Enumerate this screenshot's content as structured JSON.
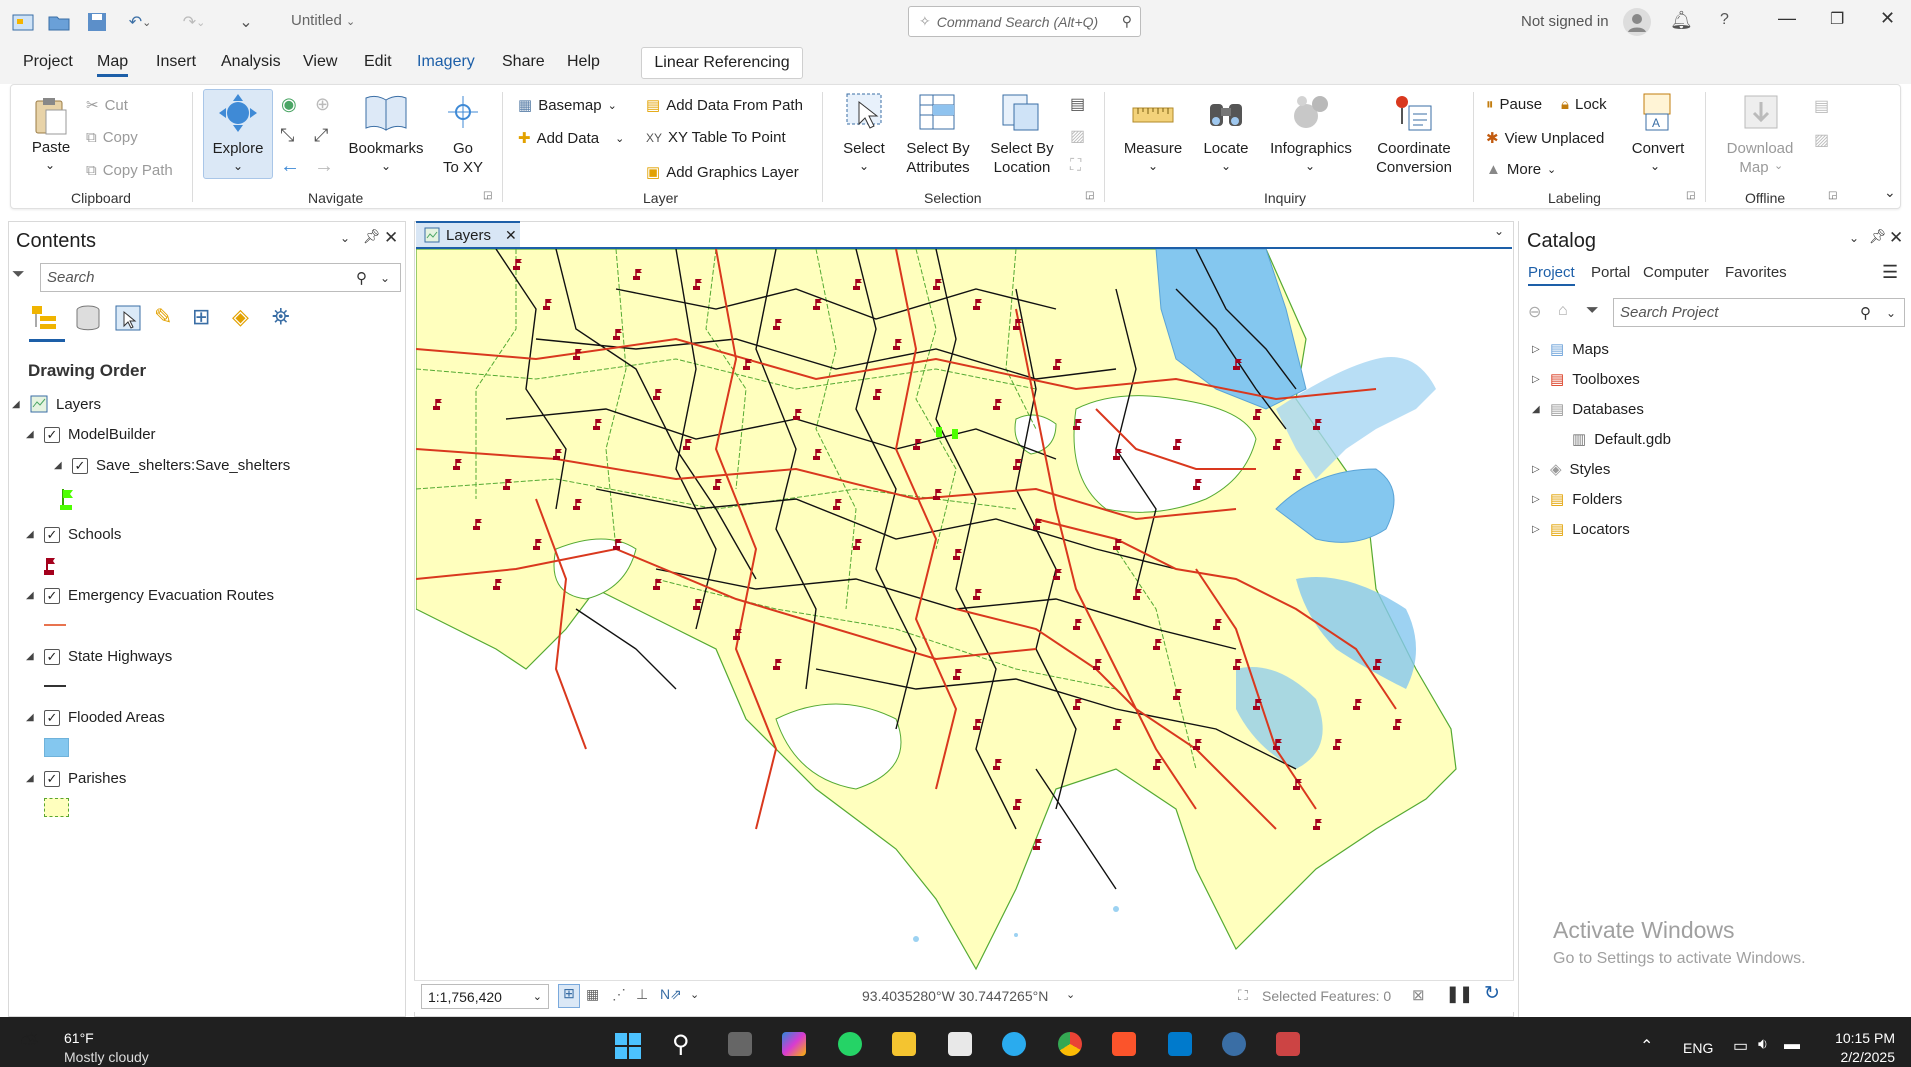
{
  "titlebar": {
    "doc_title": "Untitled",
    "command_search_placeholder": "Command Search (Alt+Q)",
    "sign_in": "Not signed in",
    "help": "?"
  },
  "menu_tabs": [
    "Project",
    "Map",
    "Insert",
    "Analysis",
    "View",
    "Edit",
    "Imagery",
    "Share",
    "Help"
  ],
  "active_tab": "Map",
  "contextual_tab": "Linear Referencing",
  "ribbon": {
    "clipboard": {
      "paste": "Paste",
      "cut": "Cut",
      "copy": "Copy",
      "copy_path": "Copy Path",
      "group": "Clipboard"
    },
    "navigate": {
      "explore": "Explore",
      "bookmarks": "Bookmarks",
      "go_to_xy_1": "Go",
      "go_to_xy_2": "To XY",
      "group": "Navigate"
    },
    "layer": {
      "basemap": "Basemap",
      "add_data": "Add Data",
      "add_data_from_path": "Add Data From Path",
      "xy_table_to_point": "XY Table To Point",
      "add_graphics_layer": "Add Graphics Layer",
      "group": "Layer"
    },
    "selection": {
      "select": "Select",
      "select_by_attributes_1": "Select By",
      "select_by_attributes_2": "Attributes",
      "select_by_location_1": "Select By",
      "select_by_location_2": "Location",
      "group": "Selection"
    },
    "inquiry": {
      "measure": "Measure",
      "locate": "Locate",
      "infographics": "Infographics",
      "coordinate_conversion_1": "Coordinate",
      "coordinate_conversion_2": "Conversion",
      "group": "Inquiry"
    },
    "labeling": {
      "pause": "Pause",
      "lock": "Lock",
      "view_unplaced": "View Unplaced",
      "more": "More",
      "convert": "Convert",
      "group": "Labeling"
    },
    "offline": {
      "download_map_1": "Download",
      "download_map_2": "Map",
      "group": "Offline"
    }
  },
  "contents": {
    "title": "Contents",
    "search_placeholder": "Search",
    "drawing_order": "Drawing Order",
    "layers_root": "Layers",
    "items": [
      {
        "label": "ModelBuilder",
        "level": 1
      },
      {
        "label": "Save_shelters:Save_shelters",
        "level": 2
      },
      {
        "label": "Schools",
        "level": 1
      },
      {
        "label": "Emergency Evacuation Routes",
        "level": 1
      },
      {
        "label": "State Highways",
        "level": 1
      },
      {
        "label": "Flooded Areas",
        "level": 1
      },
      {
        "label": "Parishes",
        "level": 1
      }
    ]
  },
  "map": {
    "tab_label": "Layers",
    "scale": "1:1,756,420",
    "coordinates": "93.4035280°W 30.7447265°N",
    "selected_features": "Selected Features: 0"
  },
  "catalog": {
    "title": "Catalog",
    "tabs": [
      "Project",
      "Portal",
      "Computer",
      "Favorites"
    ],
    "search_placeholder": "Search Project",
    "items": [
      {
        "label": "Maps"
      },
      {
        "label": "Toolboxes"
      },
      {
        "label": "Databases"
      },
      {
        "label": "Default.gdb"
      },
      {
        "label": "Styles"
      },
      {
        "label": "Folders"
      },
      {
        "label": "Locators"
      }
    ]
  },
  "activate_windows": {
    "line1": "Activate Windows",
    "line2": "Go to Settings to activate Windows."
  },
  "taskbar": {
    "temp": "61°F",
    "weather": "Mostly cloudy",
    "lang": "ENG",
    "time": "10:15 PM",
    "date": "2/2/2025"
  },
  "colors": {
    "parishes": "#ffffbe",
    "flood": "#84c7ef",
    "routes": "#d9381e",
    "highways": "#111111",
    "schools": "#a4001c",
    "accent": "#1d5fa8"
  }
}
